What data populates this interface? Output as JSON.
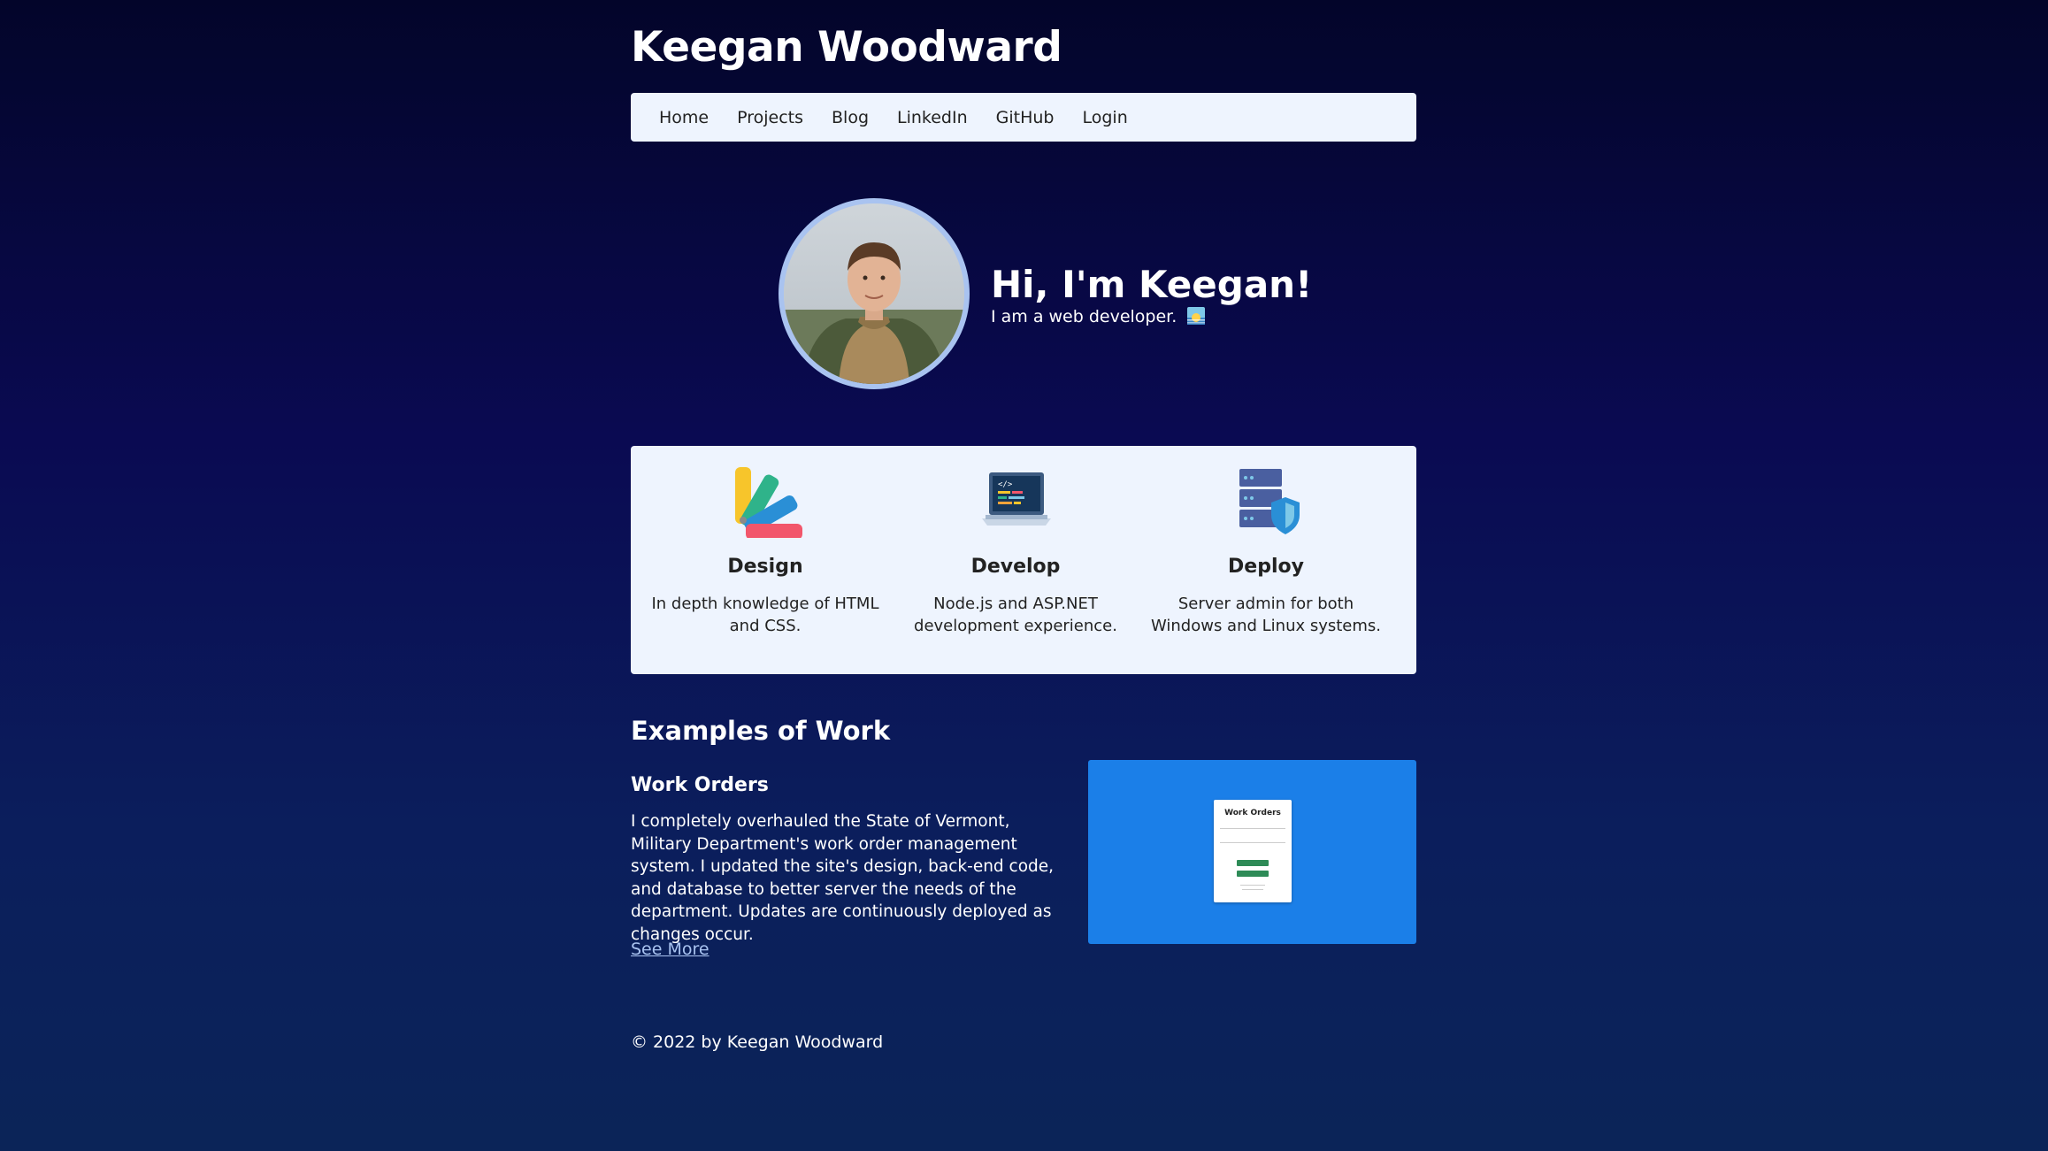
{
  "site": {
    "title": "Keegan Woodward"
  },
  "nav": {
    "items": [
      {
        "label": "Home"
      },
      {
        "label": "Projects"
      },
      {
        "label": "Blog"
      },
      {
        "label": "LinkedIn"
      },
      {
        "label": "GitHub"
      },
      {
        "label": "Login"
      }
    ]
  },
  "hero": {
    "heading": "Hi, I'm Keegan!",
    "subtitle": "I am a web developer.",
    "emoji_icon": "sunrise-icon"
  },
  "services": [
    {
      "title": "Design",
      "description": "In depth knowledge of HTML and CSS.",
      "icon": "color-palette-icon"
    },
    {
      "title": "Develop",
      "description": "Node.js and ASP.NET development experience.",
      "icon": "laptop-code-icon"
    },
    {
      "title": "Deploy",
      "description": "Server admin for both Windows and Linux systems.",
      "icon": "server-shield-icon"
    }
  ],
  "work": {
    "section_title": "Examples of Work",
    "items": [
      {
        "title": "Work Orders",
        "description": "I completely overhauled the State of Vermont, Military Department's work order management system. I updated the site's design, back-end code, and database to better server the needs of the department. Updates are continuously deployed as changes occur.",
        "link_label": "See More",
        "preview_title": "Work Orders"
      }
    ]
  },
  "footer": {
    "text": "© 2022 by Keegan Woodward"
  },
  "colors": {
    "background_top": "#03052a",
    "background_bottom": "#0b2458",
    "panel": "#eef4fe",
    "link": "#a9c3f0",
    "preview_bg": "#1b7fe8"
  }
}
